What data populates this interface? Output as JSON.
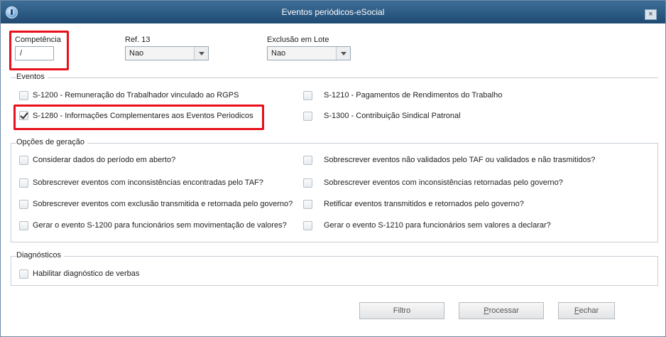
{
  "window": {
    "title": "Eventos periódicos-eSocial",
    "close_label": "×"
  },
  "fields": {
    "competencia": {
      "label": "Competência",
      "value": "/"
    },
    "ref13": {
      "label": "Ref. 13",
      "value": "Nao"
    },
    "exclusao": {
      "label": "Exclusão em Lote",
      "value": "Nao"
    }
  },
  "groups": {
    "eventos": {
      "title": "Eventos",
      "items": [
        {
          "label": "S-1200 - Remuneração do Trabalhador vinculado ao RGPS",
          "checked": false
        },
        {
          "label": "S-1210 - Pagamentos de Rendimentos do Trabalho",
          "checked": false
        },
        {
          "label": "S-1280 - Informações Complementares aos Eventos Periodicos",
          "checked": true
        },
        {
          "label": "S-1300 - Contribuição Sindical Patronal",
          "checked": false
        }
      ]
    },
    "opcoes": {
      "title": "Opções de geração",
      "items": [
        {
          "label": "Considerar dados do período em aberto?",
          "checked": false
        },
        {
          "label": "Sobrescrever eventos não validados pelo TAF ou validados e não trasmitidos?",
          "checked": false
        },
        {
          "label": "Sobrescrever eventos com inconsistências encontradas pelo TAF?",
          "checked": false
        },
        {
          "label": "Sobrescrever eventos com inconsistências retornadas pelo governo?",
          "checked": false
        },
        {
          "label": "Sobrescrever eventos com exclusão transmitida e retornada pelo governo?",
          "checked": false
        },
        {
          "label": "Retificar eventos transmitidos e retornados pelo governo?",
          "checked": false
        },
        {
          "label": "Gerar o evento S-1200 para funcionários sem movimentação de valores?",
          "checked": false
        },
        {
          "label": "Gerar o evento S-1210 para funcionários sem valores a declarar?",
          "checked": false
        }
      ]
    },
    "diagnosticos": {
      "title": "Diagnósticos",
      "items": [
        {
          "label": "Habilitar diagnóstico de verbas",
          "checked": false
        }
      ]
    }
  },
  "buttons": {
    "filtro": "Filtro",
    "processar_first": "P",
    "processar_rest": "rocessar",
    "fechar_first": "F",
    "fechar_rest": "echar"
  }
}
